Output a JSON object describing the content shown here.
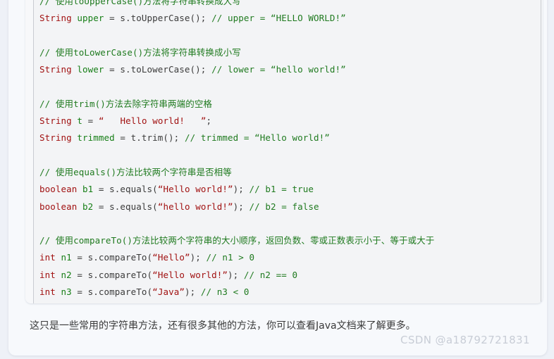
{
  "code_block": {
    "language": "java",
    "colors": {
      "comment": "#1f7a1f",
      "type": "#a11111",
      "identifier": "#167e16",
      "plain": "#3b3b3b",
      "string": "#a11111",
      "background": "#f3f4f6",
      "gutter": "#f7f8fa",
      "gutter_rule": "#c9ccd2"
    },
    "lines": [
      {
        "id": "l1",
        "tokens": [
          {
            "t": "comment",
            "v": "// 使用toUpperCase()方法将字符串转换成大写"
          }
        ]
      },
      {
        "id": "l2",
        "tokens": [
          {
            "t": "type",
            "v": "String"
          },
          {
            "t": "plain",
            "v": " "
          },
          {
            "t": "name",
            "v": "upper"
          },
          {
            "t": "plain",
            "v": " = s.toUpperCase(); "
          },
          {
            "t": "comment",
            "v": "// upper = “HELLO WORLD!”"
          }
        ]
      },
      {
        "id": "l3",
        "tokens": []
      },
      {
        "id": "l4",
        "tokens": [
          {
            "t": "comment",
            "v": "// 使用toLowerCase()方法将字符串转换成小写"
          }
        ]
      },
      {
        "id": "l5",
        "tokens": [
          {
            "t": "type",
            "v": "String"
          },
          {
            "t": "plain",
            "v": " "
          },
          {
            "t": "name",
            "v": "lower"
          },
          {
            "t": "plain",
            "v": " = s.toLowerCase(); "
          },
          {
            "t": "comment",
            "v": "// lower = “hello world!”"
          }
        ]
      },
      {
        "id": "l6",
        "tokens": []
      },
      {
        "id": "l7",
        "tokens": [
          {
            "t": "comment",
            "v": "// 使用trim()方法去除字符串两端的空格"
          }
        ]
      },
      {
        "id": "l8",
        "tokens": [
          {
            "t": "type",
            "v": "String"
          },
          {
            "t": "plain",
            "v": " "
          },
          {
            "t": "name",
            "v": "t"
          },
          {
            "t": "plain",
            "v": " = "
          },
          {
            "t": "string",
            "v": "“   Hello world!   ”"
          },
          {
            "t": "plain",
            "v": ";"
          }
        ]
      },
      {
        "id": "l9",
        "tokens": [
          {
            "t": "type",
            "v": "String"
          },
          {
            "t": "plain",
            "v": " "
          },
          {
            "t": "name",
            "v": "trimmed"
          },
          {
            "t": "plain",
            "v": " = t.trim(); "
          },
          {
            "t": "comment",
            "v": "// trimmed = “Hello world!”"
          }
        ]
      },
      {
        "id": "l10",
        "tokens": []
      },
      {
        "id": "l11",
        "tokens": [
          {
            "t": "comment",
            "v": "// 使用equals()方法比较两个字符串是否相等"
          }
        ]
      },
      {
        "id": "l12",
        "tokens": [
          {
            "t": "type",
            "v": "boolean"
          },
          {
            "t": "plain",
            "v": " "
          },
          {
            "t": "name",
            "v": "b1"
          },
          {
            "t": "plain",
            "v": " = s.equals("
          },
          {
            "t": "string",
            "v": "“Hello world!”"
          },
          {
            "t": "plain",
            "v": "); "
          },
          {
            "t": "comment",
            "v": "// b1 = true"
          }
        ]
      },
      {
        "id": "l13",
        "tokens": [
          {
            "t": "type",
            "v": "boolean"
          },
          {
            "t": "plain",
            "v": " "
          },
          {
            "t": "name",
            "v": "b2"
          },
          {
            "t": "plain",
            "v": " = s.equals("
          },
          {
            "t": "string",
            "v": "“hello world!”"
          },
          {
            "t": "plain",
            "v": "); "
          },
          {
            "t": "comment",
            "v": "// b2 = false"
          }
        ]
      },
      {
        "id": "l14",
        "tokens": []
      },
      {
        "id": "l15",
        "tokens": [
          {
            "t": "comment",
            "v": "// 使用compareTo()方法比较两个字符串的大小顺序，返回负数、零或正数表示小于、等于或大于"
          }
        ]
      },
      {
        "id": "l16",
        "tokens": [
          {
            "t": "type",
            "v": "int"
          },
          {
            "t": "plain",
            "v": " "
          },
          {
            "t": "name",
            "v": "n1"
          },
          {
            "t": "plain",
            "v": " = s.compareTo("
          },
          {
            "t": "string",
            "v": "“Hello”"
          },
          {
            "t": "plain",
            "v": "); "
          },
          {
            "t": "comment",
            "v": "// n1 > 0"
          }
        ]
      },
      {
        "id": "l17",
        "tokens": [
          {
            "t": "type",
            "v": "int"
          },
          {
            "t": "plain",
            "v": " "
          },
          {
            "t": "name",
            "v": "n2"
          },
          {
            "t": "plain",
            "v": " = s.compareTo("
          },
          {
            "t": "string",
            "v": "“Hello world!”"
          },
          {
            "t": "plain",
            "v": "); "
          },
          {
            "t": "comment",
            "v": "// n2 == 0"
          }
        ]
      },
      {
        "id": "l18",
        "tokens": [
          {
            "t": "type",
            "v": "int"
          },
          {
            "t": "plain",
            "v": " "
          },
          {
            "t": "name",
            "v": "n3"
          },
          {
            "t": "plain",
            "v": " = s.compareTo("
          },
          {
            "t": "string",
            "v": "“Java”"
          },
          {
            "t": "plain",
            "v": "); "
          },
          {
            "t": "comment",
            "v": "// n3 < 0"
          }
        ]
      }
    ]
  },
  "paragraph": {
    "text": "这只是一些常用的字符串方法，还有很多其他的方法，你可以查看Java文档来了解更多。"
  },
  "watermark": {
    "text": "CSDN @a18792721831"
  }
}
